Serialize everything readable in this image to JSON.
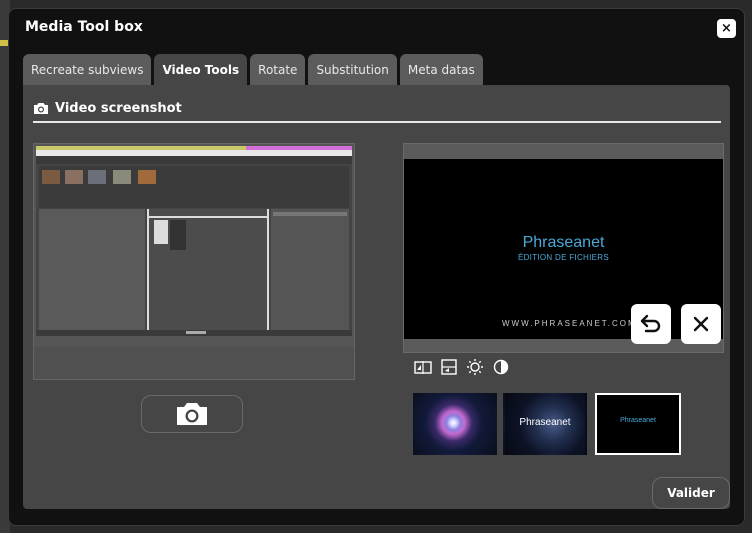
{
  "dialog": {
    "title": "Media Tool box",
    "close_label": "×"
  },
  "tabs": [
    {
      "label": "Recreate subviews",
      "active": false
    },
    {
      "label": "Video Tools",
      "active": true
    },
    {
      "label": "Rotate",
      "active": false
    },
    {
      "label": "Substitution",
      "active": false
    },
    {
      "label": "Meta datas",
      "active": false
    }
  ],
  "section": {
    "title": "Video screenshot",
    "icon": "camera-icon"
  },
  "player": {
    "brand": "Phraseanet",
    "subtitle": "ÉDITION DE FICHIERS",
    "url": "WWW.PHRASEANET.COM"
  },
  "overlay": {
    "undo_icon": "undo-icon",
    "close_icon": "close-icon"
  },
  "tools": [
    "flip-horizontal-icon",
    "flip-vertical-icon",
    "brightness-icon",
    "contrast-icon"
  ],
  "thumbnails": [
    {
      "label": ""
    },
    {
      "label": "Phraseanet"
    },
    {
      "label": "Phraseanet"
    }
  ],
  "buttons": {
    "capture_icon": "camera-icon",
    "validate": "Valider"
  },
  "colors": {
    "dialog_bg": "#111111",
    "panel_bg": "#464646",
    "tab_bg": "#5c5c5c",
    "brand_blue": "#4aa9d9"
  }
}
